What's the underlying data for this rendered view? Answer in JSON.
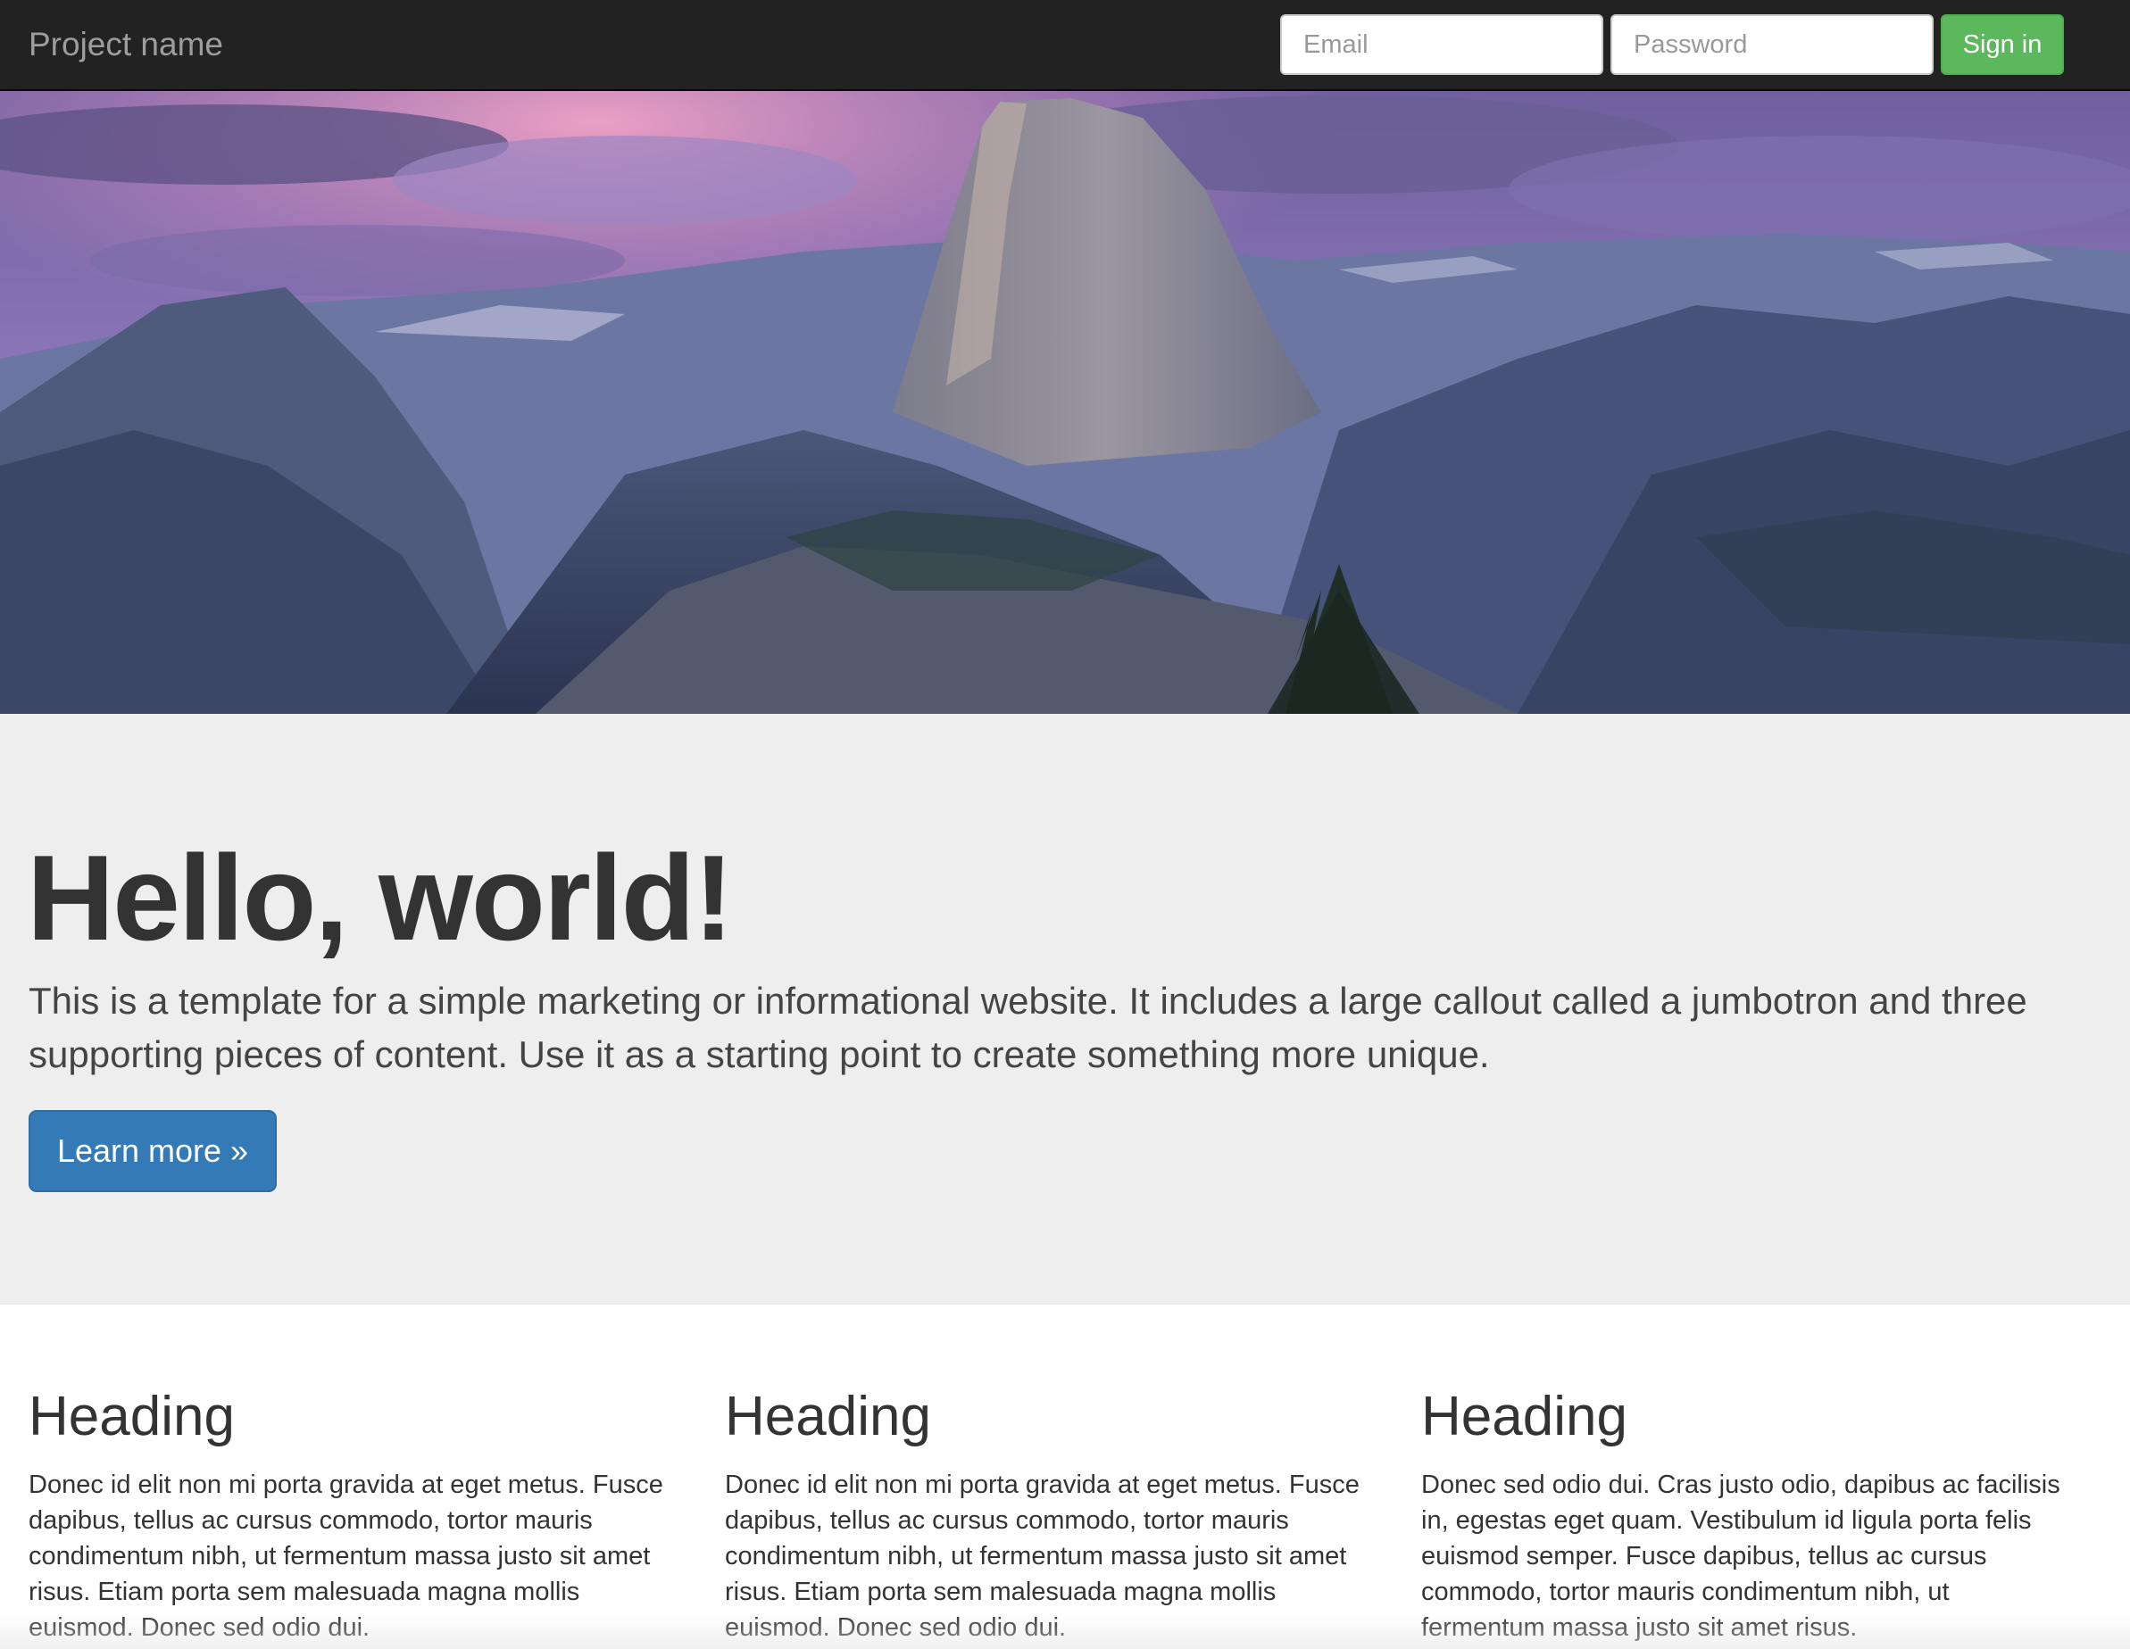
{
  "navbar": {
    "brand": "Project name",
    "email_placeholder": "Email",
    "password_placeholder": "Password",
    "signin_label": "Sign in"
  },
  "colors": {
    "navbar_bg": "#222222",
    "signin_bg": "#5cb85c",
    "primary_button": "#337ab7",
    "jumbotron_bg": "#eeeeee"
  },
  "jumbotron": {
    "title": "Hello, world!",
    "text": "This is a template for a simple marketing or informational website. It includes a large callout called a jumbotron and three supporting pieces of content. Use it as a starting point to create something more unique.",
    "button_label": "Learn more »"
  },
  "columns": [
    {
      "heading": "Heading",
      "text": "Donec id elit non mi porta gravida at eget metus. Fusce dapibus, tellus ac cursus commodo, tortor mauris condimentum nibh, ut fermentum massa justo sit amet risus. Etiam porta sem malesuada magna mollis euismod. Donec sed odio dui."
    },
    {
      "heading": "Heading",
      "text": "Donec id elit non mi porta gravida at eget metus. Fusce dapibus, tellus ac cursus commodo, tortor mauris condimentum nibh, ut fermentum massa justo sit amet risus. Etiam porta sem malesuada magna mollis euismod. Donec sed odio dui."
    },
    {
      "heading": "Heading",
      "text": "Donec sed odio dui. Cras justo odio, dapibus ac facilisis in, egestas eget quam. Vestibulum id ligula porta felis euismod semper. Fusce dapibus, tellus ac cursus commodo, tortor mauris condimentum nibh, ut fermentum massa justo sit amet risus."
    }
  ]
}
